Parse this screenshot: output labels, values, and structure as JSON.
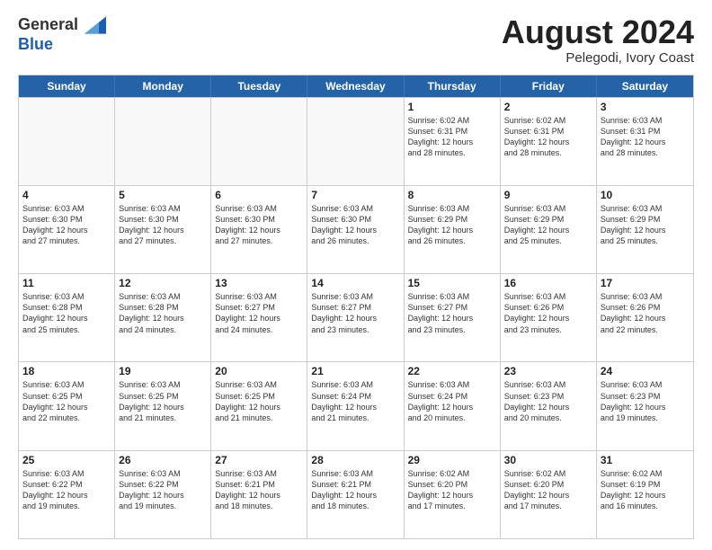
{
  "header": {
    "logo_line1": "General",
    "logo_line2": "Blue",
    "month_title": "August 2024",
    "location": "Pelegodi, Ivory Coast"
  },
  "calendar": {
    "days_of_week": [
      "Sunday",
      "Monday",
      "Tuesday",
      "Wednesday",
      "Thursday",
      "Friday",
      "Saturday"
    ],
    "rows": [
      [
        {
          "day": "",
          "info": "",
          "empty": true
        },
        {
          "day": "",
          "info": "",
          "empty": true
        },
        {
          "day": "",
          "info": "",
          "empty": true
        },
        {
          "day": "",
          "info": "",
          "empty": true
        },
        {
          "day": "1",
          "info": "Sunrise: 6:02 AM\nSunset: 6:31 PM\nDaylight: 12 hours\nand 28 minutes.",
          "empty": false
        },
        {
          "day": "2",
          "info": "Sunrise: 6:02 AM\nSunset: 6:31 PM\nDaylight: 12 hours\nand 28 minutes.",
          "empty": false
        },
        {
          "day": "3",
          "info": "Sunrise: 6:03 AM\nSunset: 6:31 PM\nDaylight: 12 hours\nand 28 minutes.",
          "empty": false
        }
      ],
      [
        {
          "day": "4",
          "info": "Sunrise: 6:03 AM\nSunset: 6:30 PM\nDaylight: 12 hours\nand 27 minutes.",
          "empty": false
        },
        {
          "day": "5",
          "info": "Sunrise: 6:03 AM\nSunset: 6:30 PM\nDaylight: 12 hours\nand 27 minutes.",
          "empty": false
        },
        {
          "day": "6",
          "info": "Sunrise: 6:03 AM\nSunset: 6:30 PM\nDaylight: 12 hours\nand 27 minutes.",
          "empty": false
        },
        {
          "day": "7",
          "info": "Sunrise: 6:03 AM\nSunset: 6:30 PM\nDaylight: 12 hours\nand 26 minutes.",
          "empty": false
        },
        {
          "day": "8",
          "info": "Sunrise: 6:03 AM\nSunset: 6:29 PM\nDaylight: 12 hours\nand 26 minutes.",
          "empty": false
        },
        {
          "day": "9",
          "info": "Sunrise: 6:03 AM\nSunset: 6:29 PM\nDaylight: 12 hours\nand 25 minutes.",
          "empty": false
        },
        {
          "day": "10",
          "info": "Sunrise: 6:03 AM\nSunset: 6:29 PM\nDaylight: 12 hours\nand 25 minutes.",
          "empty": false
        }
      ],
      [
        {
          "day": "11",
          "info": "Sunrise: 6:03 AM\nSunset: 6:28 PM\nDaylight: 12 hours\nand 25 minutes.",
          "empty": false
        },
        {
          "day": "12",
          "info": "Sunrise: 6:03 AM\nSunset: 6:28 PM\nDaylight: 12 hours\nand 24 minutes.",
          "empty": false
        },
        {
          "day": "13",
          "info": "Sunrise: 6:03 AM\nSunset: 6:27 PM\nDaylight: 12 hours\nand 24 minutes.",
          "empty": false
        },
        {
          "day": "14",
          "info": "Sunrise: 6:03 AM\nSunset: 6:27 PM\nDaylight: 12 hours\nand 23 minutes.",
          "empty": false
        },
        {
          "day": "15",
          "info": "Sunrise: 6:03 AM\nSunset: 6:27 PM\nDaylight: 12 hours\nand 23 minutes.",
          "empty": false
        },
        {
          "day": "16",
          "info": "Sunrise: 6:03 AM\nSunset: 6:26 PM\nDaylight: 12 hours\nand 23 minutes.",
          "empty": false
        },
        {
          "day": "17",
          "info": "Sunrise: 6:03 AM\nSunset: 6:26 PM\nDaylight: 12 hours\nand 22 minutes.",
          "empty": false
        }
      ],
      [
        {
          "day": "18",
          "info": "Sunrise: 6:03 AM\nSunset: 6:25 PM\nDaylight: 12 hours\nand 22 minutes.",
          "empty": false
        },
        {
          "day": "19",
          "info": "Sunrise: 6:03 AM\nSunset: 6:25 PM\nDaylight: 12 hours\nand 21 minutes.",
          "empty": false
        },
        {
          "day": "20",
          "info": "Sunrise: 6:03 AM\nSunset: 6:25 PM\nDaylight: 12 hours\nand 21 minutes.",
          "empty": false
        },
        {
          "day": "21",
          "info": "Sunrise: 6:03 AM\nSunset: 6:24 PM\nDaylight: 12 hours\nand 21 minutes.",
          "empty": false
        },
        {
          "day": "22",
          "info": "Sunrise: 6:03 AM\nSunset: 6:24 PM\nDaylight: 12 hours\nand 20 minutes.",
          "empty": false
        },
        {
          "day": "23",
          "info": "Sunrise: 6:03 AM\nSunset: 6:23 PM\nDaylight: 12 hours\nand 20 minutes.",
          "empty": false
        },
        {
          "day": "24",
          "info": "Sunrise: 6:03 AM\nSunset: 6:23 PM\nDaylight: 12 hours\nand 19 minutes.",
          "empty": false
        }
      ],
      [
        {
          "day": "25",
          "info": "Sunrise: 6:03 AM\nSunset: 6:22 PM\nDaylight: 12 hours\nand 19 minutes.",
          "empty": false
        },
        {
          "day": "26",
          "info": "Sunrise: 6:03 AM\nSunset: 6:22 PM\nDaylight: 12 hours\nand 19 minutes.",
          "empty": false
        },
        {
          "day": "27",
          "info": "Sunrise: 6:03 AM\nSunset: 6:21 PM\nDaylight: 12 hours\nand 18 minutes.",
          "empty": false
        },
        {
          "day": "28",
          "info": "Sunrise: 6:03 AM\nSunset: 6:21 PM\nDaylight: 12 hours\nand 18 minutes.",
          "empty": false
        },
        {
          "day": "29",
          "info": "Sunrise: 6:02 AM\nSunset: 6:20 PM\nDaylight: 12 hours\nand 17 minutes.",
          "empty": false
        },
        {
          "day": "30",
          "info": "Sunrise: 6:02 AM\nSunset: 6:20 PM\nDaylight: 12 hours\nand 17 minutes.",
          "empty": false
        },
        {
          "day": "31",
          "info": "Sunrise: 6:02 AM\nSunset: 6:19 PM\nDaylight: 12 hours\nand 16 minutes.",
          "empty": false
        }
      ]
    ]
  }
}
